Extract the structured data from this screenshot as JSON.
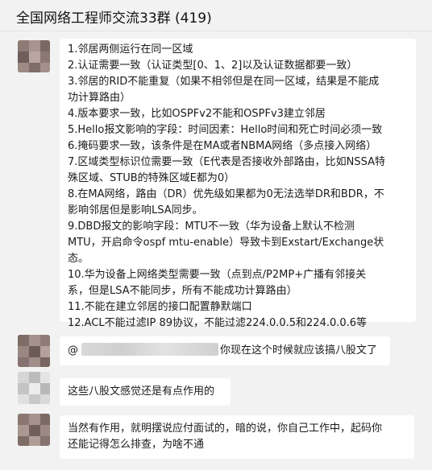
{
  "window": {
    "title": "全国网络工程师交流33群 (419)"
  },
  "messages": [
    {
      "lines": [
        "1.邻居两侧运行在同一区域",
        "2.认证需要一致（认证类型[0、1、2]以及认证数据都要一致）",
        "3.邻居的RID不能重复（如果不相邻但是在同一区域，结果是不能成",
        "功计算路由）",
        "4.版本要求一致，比如OSPFv2不能和OSPFv3建立邻居",
        "5.Hello报文影响的字段：时间因素：Hello时间和死亡时间必须一致",
        "6.掩码要求一致，该条件是在MA或者NBMA网络（多点接入网络）",
        "7.区域类型标识位需要一致（E代表是否接收外部路由，比如NSSA特",
        "殊区域、STUB的特殊区域E都为0）",
        "8.在MA网络，路由（DR）优先级如果都为0无法选举DR和BDR，不",
        "影响邻居但是影响LSA同步。",
        "9.DBD报文的影响字段：MTU不一致（华为设备上默认不检测",
        "MTU，开启命令ospf mtu-enable）导致卡到Exstart/Exchange状",
        "态。",
        "10.华为设备上网络类型需要一致（点到点/P2MP+广播有邻接关",
        "系，但是LSA不能同步，所有不能成功计算路由）",
        "11.不能在建立邻居的接口配置静默端口",
        "12.ACL不能过滤IP 89协议，不能过滤224.0.0.5和224.0.0.6等"
      ]
    },
    {
      "at_symbol": "@",
      "text": "你现在这个时候就应该搞八股文了"
    },
    {
      "text": "这些八股文感觉还是有点作用的"
    },
    {
      "lines": [
        "当然有作用，就明摆说应付面试的，暗的说，你自己工作中，起码你",
        "还能记得怎么排查，为啥不通"
      ]
    }
  ]
}
